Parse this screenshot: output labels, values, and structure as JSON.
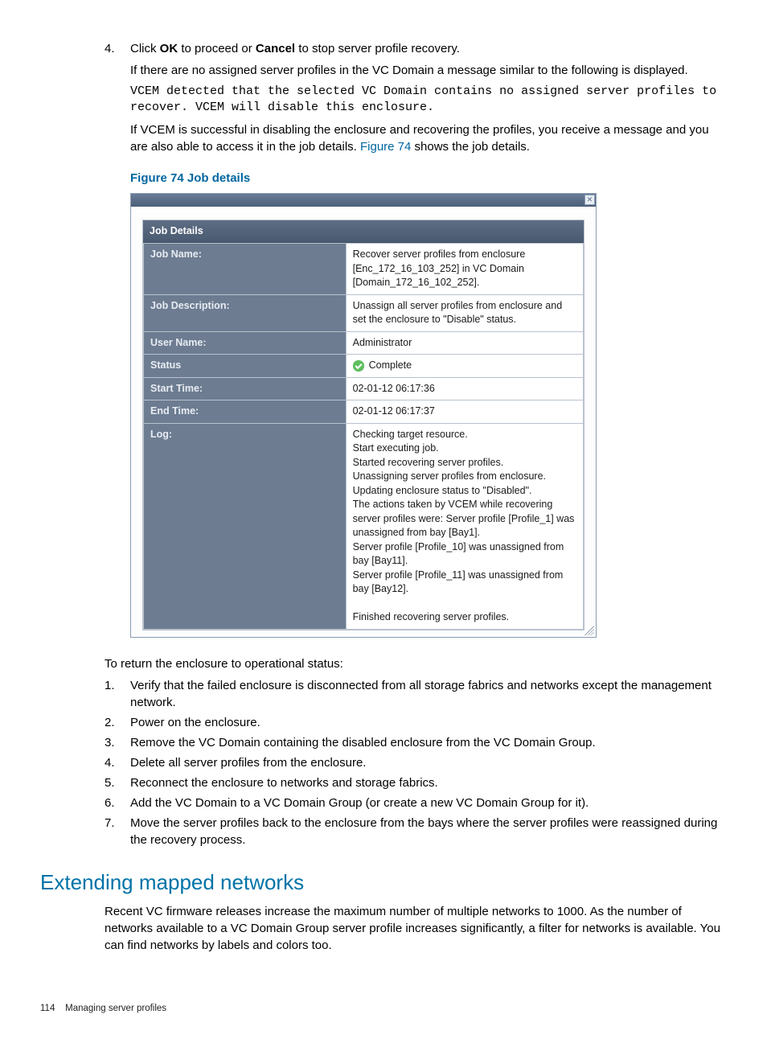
{
  "step4": {
    "num": "4.",
    "text_prefix": "Click ",
    "ok": "OK",
    "mid": " to proceed or ",
    "cancel": "Cancel",
    "suffix": " to stop server profile recovery.",
    "note": "If there are no assigned server profiles in the VC Domain a message similar to the following is displayed.",
    "code": "VCEM detected that the selected VC Domain contains no assigned server profiles to recover. VCEM will disable this enclosure.",
    "success_prefix": "If VCEM is successful in disabling the enclosure and recovering the profiles, you receive a message and you are also able to access it in the job details. ",
    "fig_link": "Figure 74",
    "success_suffix": " shows the job details."
  },
  "figure_caption": "Figure 74 Job details",
  "dialog": {
    "panel_title": "Job Details",
    "rows": {
      "job_name_label": "Job Name:",
      "job_name_value": "Recover server profiles from enclosure [Enc_172_16_103_252] in VC Domain [Domain_172_16_102_252].",
      "job_desc_label": "Job Description:",
      "job_desc_value": "Unassign all server profiles from enclosure and set the enclosure to \"Disable\" status.",
      "user_label": "User Name:",
      "user_value": "Administrator",
      "status_label": "Status",
      "status_value": "Complete",
      "start_label": "Start Time:",
      "start_value": "02-01-12 06:17:36",
      "end_label": "End Time:",
      "end_value": "02-01-12 06:17:37",
      "log_label": "Log:",
      "log_value": "Checking target resource.\nStart executing job.\nStarted recovering server profiles.\nUnassigning server profiles from enclosure.\nUpdating enclosure status to \"Disabled\".\nThe actions taken by VCEM while recovering server profiles were: Server profile [Profile_1] was unassigned from bay [Bay1].\nServer profile [Profile_10] was unassigned from bay [Bay11].\nServer profile [Profile_11] was unassigned from bay [Bay12].\n\nFinished recovering server profiles."
    }
  },
  "return_intro": "To return the enclosure to operational status:",
  "return_steps": [
    "Verify that the failed enclosure is disconnected from all storage fabrics and networks except the management network.",
    "Power on the enclosure.",
    "Remove the VC Domain containing the disabled enclosure from the VC Domain Group.",
    "Delete all server profiles from the enclosure.",
    "Reconnect the enclosure to networks and storage fabrics.",
    "Add the VC Domain to a VC Domain Group (or create a new VC Domain Group for it).",
    "Move the server profiles back to the enclosure from the bays where the server profiles were reassigned during the recovery process."
  ],
  "section_heading": "Extending mapped networks",
  "section_body": "Recent VC firmware releases increase the maximum number of multiple networks to 1000. As the number of networks available to a VC Domain Group server profile increases significantly, a filter for networks is available. You can find networks by labels and colors too.",
  "footer": {
    "page": "114",
    "title": "Managing server profiles"
  }
}
